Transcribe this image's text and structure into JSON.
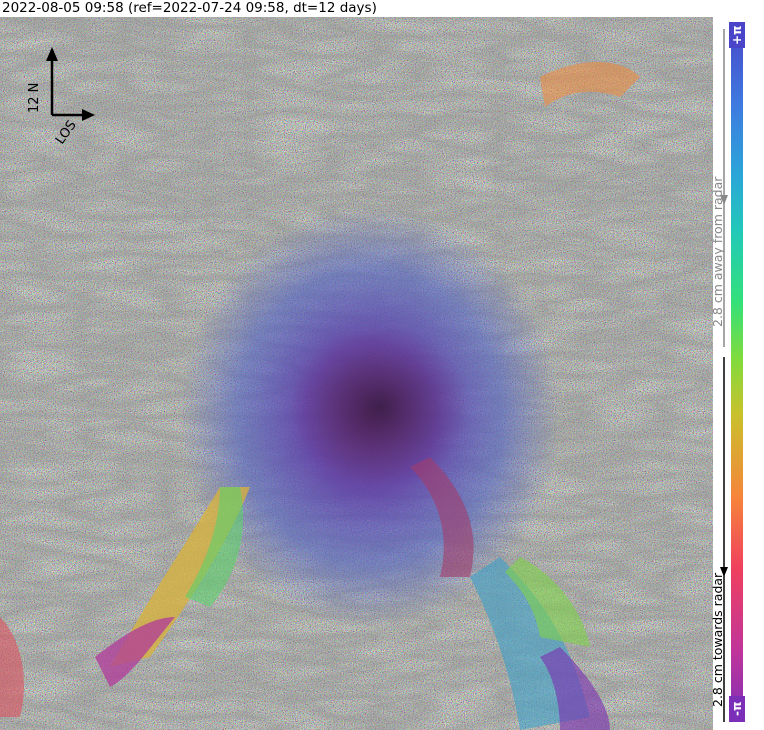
{
  "title": "2022-08-05 09:58 (ref=2022-07-24 09:58, dt=12 days)",
  "map": {
    "north_label": "12 N",
    "los_label": "LOS"
  },
  "colorbar": {
    "top_label": "+π",
    "bottom_label": "-π",
    "away_label": "2.8 cm away from radar",
    "towards_label": "2.8 cm towards radar",
    "away_color": "#888888",
    "towards_color": "#000000",
    "gradient": [
      "#7b2fb8",
      "#c0359b",
      "#f0405e",
      "#f6843a",
      "#c9c12c",
      "#7fdc3d",
      "#33e07a",
      "#22c9b8",
      "#2aa6d8",
      "#3e7be0",
      "#4a45c8"
    ]
  }
}
